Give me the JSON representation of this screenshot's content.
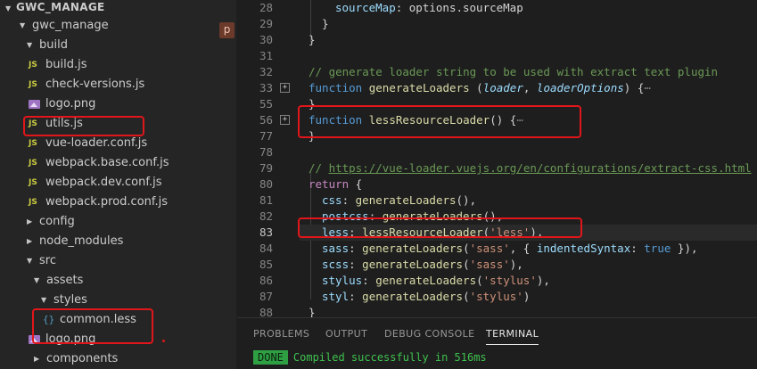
{
  "explorer": {
    "root": "GWC_MANAGE",
    "badge": "p",
    "tree": [
      {
        "label": "gwc_manage",
        "type": "folder",
        "open": true,
        "depth": 1
      },
      {
        "label": "build",
        "type": "folder",
        "open": true,
        "depth": 2
      },
      {
        "label": "build.js",
        "type": "js",
        "depth": 3
      },
      {
        "label": "check-versions.js",
        "type": "js",
        "depth": 3
      },
      {
        "label": "logo.png",
        "type": "image",
        "depth": 3
      },
      {
        "label": "utils.js",
        "type": "js",
        "depth": 3
      },
      {
        "label": "vue-loader.conf.js",
        "type": "js",
        "depth": 3
      },
      {
        "label": "webpack.base.conf.js",
        "type": "js",
        "depth": 3
      },
      {
        "label": "webpack.dev.conf.js",
        "type": "js",
        "depth": 3
      },
      {
        "label": "webpack.prod.conf.js",
        "type": "js",
        "depth": 3
      },
      {
        "label": "config",
        "type": "folder",
        "open": false,
        "depth": 2
      },
      {
        "label": "node_modules",
        "type": "folder",
        "open": false,
        "depth": 2
      },
      {
        "label": "src",
        "type": "folder",
        "open": true,
        "depth": 2
      },
      {
        "label": "assets",
        "type": "folder",
        "open": true,
        "depth": 3
      },
      {
        "label": "styles",
        "type": "folder",
        "open": true,
        "depth": 4
      },
      {
        "label": "common.less",
        "type": "less",
        "depth": 5
      },
      {
        "label": "logo.png",
        "type": "image",
        "depth": 4
      },
      {
        "label": "components",
        "type": "folder",
        "open": false,
        "depth": 3
      }
    ]
  },
  "editor": {
    "active_line": "83",
    "lines": [
      {
        "n": "28",
        "code": "sourceMap: options.sourceMap"
      },
      {
        "n": "29",
        "code": "}"
      },
      {
        "n": "30",
        "code": "}"
      },
      {
        "n": "31",
        "code": ""
      },
      {
        "n": "32",
        "code": "// generate loader string to be used with extract text plugin"
      },
      {
        "n": "33",
        "code": "function generateLoaders (loader, loaderOptions) {⋯"
      },
      {
        "n": "55",
        "code": "}"
      },
      {
        "n": "56",
        "code": "function lessResourceLoader() {⋯"
      },
      {
        "n": "77",
        "code": "}"
      },
      {
        "n": "78",
        "code": ""
      },
      {
        "n": "79",
        "code": "// https://vue-loader.vuejs.org/en/configurations/extract-css.html"
      },
      {
        "n": "80",
        "code": "return {"
      },
      {
        "n": "81",
        "code": "css: generateLoaders(),"
      },
      {
        "n": "82",
        "code": "postcss: generateLoaders(),"
      },
      {
        "n": "83",
        "code": "less: lessResourceLoader('less'),"
      },
      {
        "n": "84",
        "code": "sass: generateLoaders('sass', { indentedSyntax: true }),"
      },
      {
        "n": "85",
        "code": "scss: generateLoaders('sass'),"
      },
      {
        "n": "86",
        "code": "stylus: generateLoaders('stylus'),"
      },
      {
        "n": "87",
        "code": "styl: generateLoaders('stylus')"
      },
      {
        "n": "88",
        "code": "}"
      }
    ]
  },
  "panel": {
    "tabs": [
      "PROBLEMS",
      "OUTPUT",
      "DEBUG CONSOLE",
      "TERMINAL"
    ],
    "active_tab": "TERMINAL",
    "terminal": {
      "badge": "DONE",
      "message": "Compiled successfully in 516ms"
    }
  },
  "colors": {
    "highlight": "#e0161b",
    "done": "#2ea043",
    "keyword": "#569cd6",
    "function": "#dcdcaa"
  }
}
